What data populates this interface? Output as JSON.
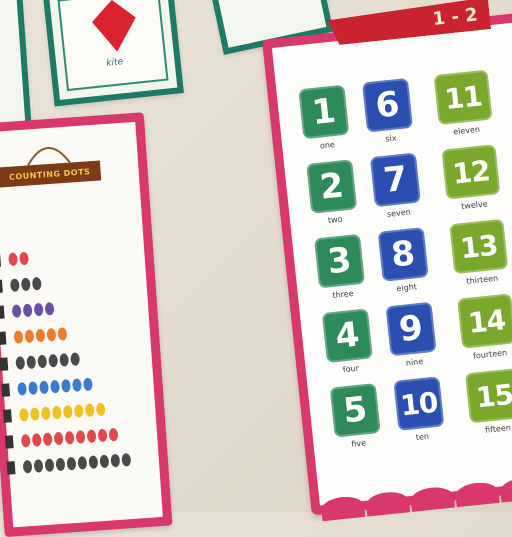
{
  "kite_card": {
    "label": "kite"
  },
  "counting_poster": {
    "title": "COUNTING DOTS"
  },
  "numbers_poster": {
    "ribbon": "1 - 2",
    "colors": {
      "green": "#2f8a5a",
      "blue": "#2a4fb0",
      "lime": "#79a82c",
      "border": "#d8386c"
    },
    "items": [
      {
        "number": "1",
        "word": "one"
      },
      {
        "number": "2",
        "word": "two"
      },
      {
        "number": "3",
        "word": "three"
      },
      {
        "number": "4",
        "word": "four"
      },
      {
        "number": "5",
        "word": "five"
      },
      {
        "number": "6",
        "word": "six"
      },
      {
        "number": "7",
        "word": "seven"
      },
      {
        "number": "8",
        "word": "eight"
      },
      {
        "number": "9",
        "word": "nine"
      },
      {
        "number": "10",
        "word": "ten"
      },
      {
        "number": "11",
        "word": "eleven"
      },
      {
        "number": "12",
        "word": "twelve"
      },
      {
        "number": "13",
        "word": "thirteen"
      },
      {
        "number": "14",
        "word": "fourteen"
      },
      {
        "number": "15",
        "word": "fifteen"
      }
    ]
  },
  "dot_rows": [
    {
      "count": 2,
      "color": "#e0484c"
    },
    {
      "count": 3,
      "color": "#4a4a4a"
    },
    {
      "count": 4,
      "color": "#6a4fa8"
    },
    {
      "count": 5,
      "color": "#ef7b2a"
    },
    {
      "count": 6,
      "color": "#4a4a4a"
    },
    {
      "count": 7,
      "color": "#3a7bd0"
    },
    {
      "count": 8,
      "color": "#f0c020"
    },
    {
      "count": 9,
      "color": "#e0484c"
    },
    {
      "count": 10,
      "color": "#4a4a4a"
    }
  ]
}
